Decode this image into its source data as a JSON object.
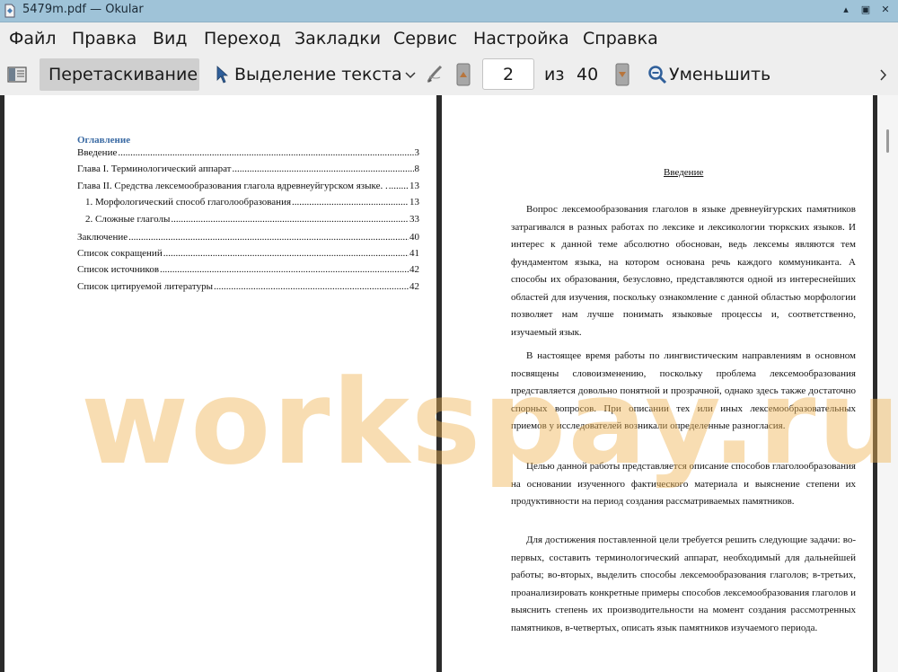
{
  "window": {
    "title": "5479m.pdf  — Okular",
    "controls": {
      "restore": "▴",
      "maximize": "▣",
      "close": "✕"
    }
  },
  "menu": [
    "Файл",
    "Правка",
    "Вид",
    "Переход",
    "Закладки",
    "Сервис",
    "Настройка",
    "Справка"
  ],
  "toolbar": {
    "sidebar_icon": "sidebar-toggle-icon",
    "drag_label": "Перетаскивание",
    "select_label": "Выделение текста",
    "page_value": "2",
    "of_label": "из",
    "total_pages": "40",
    "zoom_out_label": "Уменьшить",
    "more_icon": "chevron-right-icon"
  },
  "toc": {
    "heading": "Оглавление",
    "rows": [
      {
        "label": "Введение",
        "page": "3"
      },
      {
        "label": "Глава I. Терминологический аппарат",
        "page": "8"
      },
      {
        "label": "Глава II. Средства лексемообразования глагола вдревнеуйгурском языке. .",
        "page": "13"
      },
      {
        "label": "1.   Морфологический способ глаголообразования",
        "page": "13"
      },
      {
        "label": "2.   Сложные глаголы",
        "page": "33"
      },
      {
        "label": "Заключение",
        "page": "40"
      },
      {
        "label": "Список сокращений",
        "page": "41"
      },
      {
        "label": "Список источников",
        "page": "42"
      },
      {
        "label": "Список цитируемой литературы",
        "page": "42"
      }
    ]
  },
  "intro": {
    "title": "Введение",
    "paragraphs": [
      "Вопрос лексемообразования глаголов в языке древнеуйгурских памятников затрагивался в разных работах по лексике и лексикологии тюркских языков. И интерес к данной теме абсолютно обоснован, ведь лексемы являются тем фундаментом языка, на котором основана речь каждого коммуниканта. А способы их образования, безусловно, представляются одной из интереснейших областей для изучения, поскольку ознакомление с данной областью морфологии позволяет нам лучше понимать языковые процессы и, соответственно, изучаемый язык.",
      "В настоящее время работы по лингвистическим направлениям в основном посвящены словоизменению, поскольку проблема лексемообразования представляется довольно понятной и прозрачной, однако здесь также достаточно спорных вопросов. При описании тех или иных лексемообразовательных приемов у исследователей возникали определенные разногласия.",
      "Целью данной работы представляется описание способов глаголообразования на основании изученного фактического материала и выяснение степени их продуктивности на период создания рассматриваемых памятников.",
      "Для достижения поставленной цели требуется решить следующие задачи: во-первых, составить терминологический аппарат, необходимый для дальнейшей работы; во-вторых, выделить способы лексемообразования глаголов; в-третьих, проанализировать конкретные примеры способов лексемообразования глаголов и выяснить степень их производительности на момент создания рассмотренных памятников, в-четвертых, описать язык памятников изучаемого периода."
    ]
  },
  "watermark": "workspay.ru"
}
